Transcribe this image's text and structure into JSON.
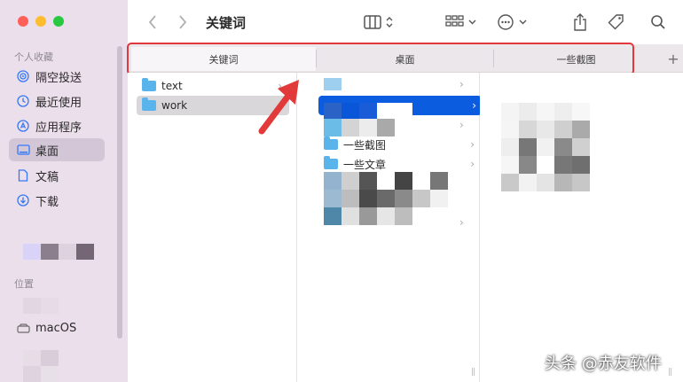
{
  "window": {
    "title": "关键词"
  },
  "sidebar": {
    "favorites_header": "个人收藏",
    "items": [
      {
        "label": "隔空投送",
        "icon": "airdrop-icon"
      },
      {
        "label": "最近使用",
        "icon": "clock-icon"
      },
      {
        "label": "应用程序",
        "icon": "apps-icon"
      },
      {
        "label": "桌面",
        "icon": "desktop-icon",
        "active": true
      },
      {
        "label": "文稿",
        "icon": "document-icon"
      },
      {
        "label": "下载",
        "icon": "download-icon"
      }
    ],
    "locations_header": "位置",
    "locations": [
      {
        "label": "macOS",
        "icon": "disk-icon"
      }
    ]
  },
  "tabs": [
    {
      "label": "关键词",
      "active": true
    },
    {
      "label": "桌面",
      "active": false
    },
    {
      "label": "一些截图",
      "active": false
    }
  ],
  "columns": {
    "col1": [
      {
        "name": "text",
        "selected": false
      },
      {
        "name": "work",
        "selected": true
      }
    ],
    "col2": [
      {
        "name": "一些截图"
      },
      {
        "name": "一些文章"
      }
    ]
  },
  "watermark": "头条 @赤友软件",
  "colors": {
    "highlight_border": "#e0383d",
    "selection_blue": "#0b5cdf",
    "folder": "#5ab4ec"
  }
}
